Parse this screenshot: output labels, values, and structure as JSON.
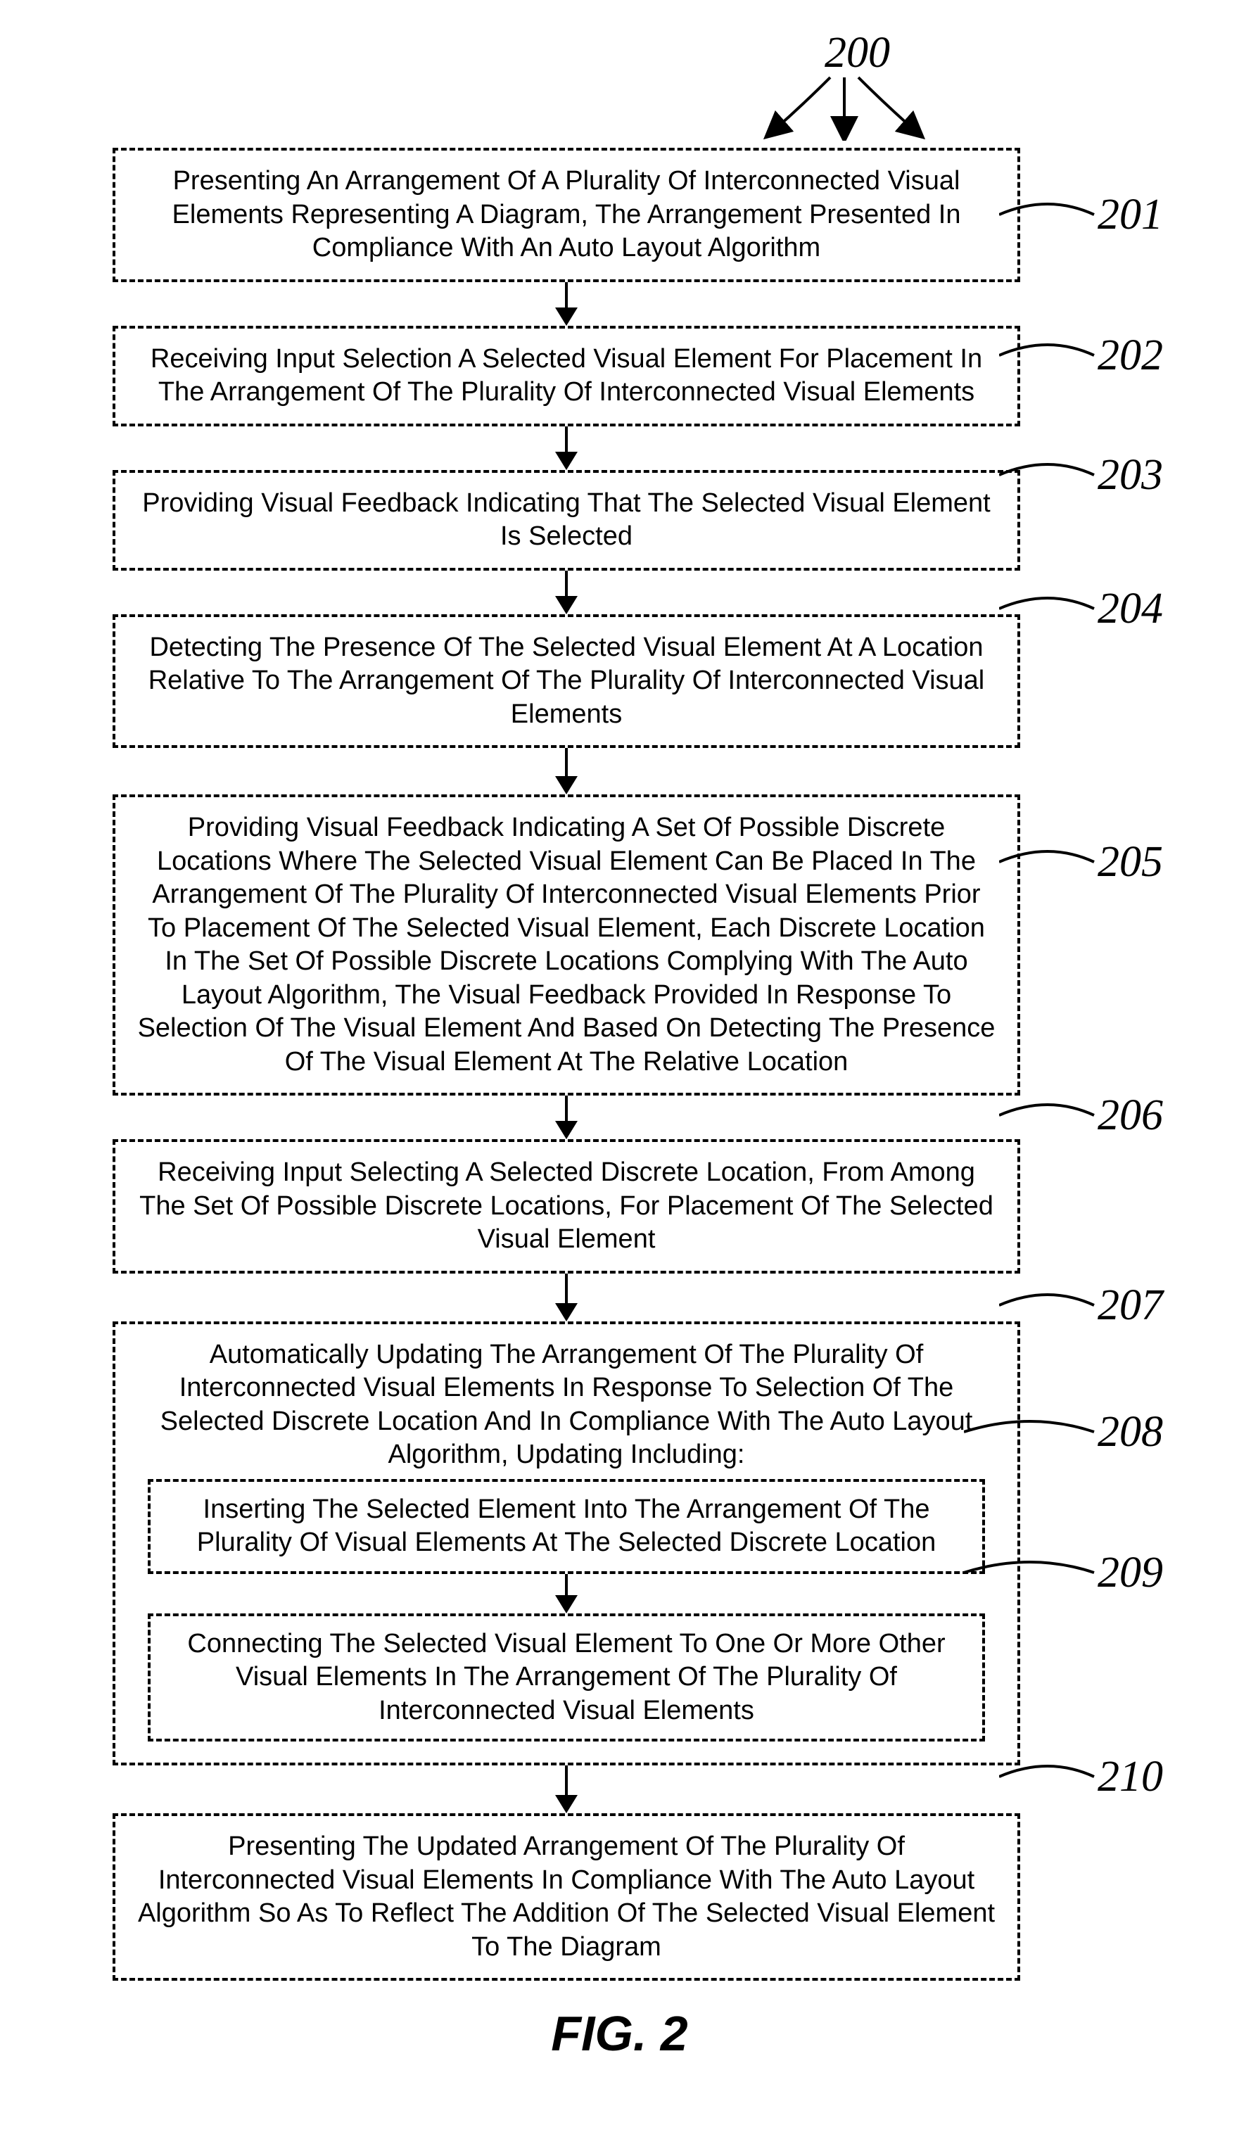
{
  "figure_label": "FIG.  2",
  "top_ref": "200",
  "steps": [
    {
      "id": "201",
      "text": "Presenting An Arrangement Of A Plurality Of Interconnected Visual Elements Representing A Diagram, The Arrangement Presented In Compliance With An Auto Layout Algorithm"
    },
    {
      "id": "202",
      "text": "Receiving Input Selection A Selected Visual Element For Placement In The Arrangement Of The Plurality Of Interconnected Visual Elements"
    },
    {
      "id": "203",
      "text": "Providing Visual Feedback Indicating That The Selected Visual Element Is Selected"
    },
    {
      "id": "204",
      "text": "Detecting The Presence Of The Selected Visual Element At A Location Relative To The Arrangement Of The Plurality Of Interconnected Visual Elements"
    },
    {
      "id": "205",
      "text": "Providing Visual Feedback Indicating A Set Of Possible Discrete Locations Where The Selected Visual Element Can Be Placed In The Arrangement Of The Plurality Of Interconnected Visual Elements Prior To Placement Of The Selected Visual Element, Each Discrete Location In The Set Of Possible Discrete Locations Complying With The Auto Layout Algorithm, The Visual Feedback Provided In Response To Selection Of The Visual Element And Based On Detecting The Presence Of The Visual Element At The Relative Location"
    },
    {
      "id": "206",
      "text": "Receiving Input Selecting A Selected Discrete Location, From Among The Set Of Possible Discrete Locations, For Placement Of The Selected Visual Element"
    },
    {
      "id": "207",
      "text": "Automatically Updating The Arrangement Of The Plurality Of Interconnected Visual Elements In Response To Selection Of The Selected Discrete Location And In Compliance With The Auto Layout Algorithm, Updating Including:"
    },
    {
      "id": "208",
      "text": "Inserting The Selected Element Into The Arrangement Of The Plurality Of Visual Elements At The Selected Discrete Location"
    },
    {
      "id": "209",
      "text": "Connecting The Selected Visual Element To One Or More Other Visual Elements In The Arrangement Of The Plurality Of Interconnected Visual Elements"
    },
    {
      "id": "210",
      "text": "Presenting The Updated Arrangement Of The Plurality Of Interconnected Visual Elements In Compliance With The Auto Layout Algorithm So As To Reflect The Addition Of The Selected Visual Element To The Diagram"
    }
  ]
}
